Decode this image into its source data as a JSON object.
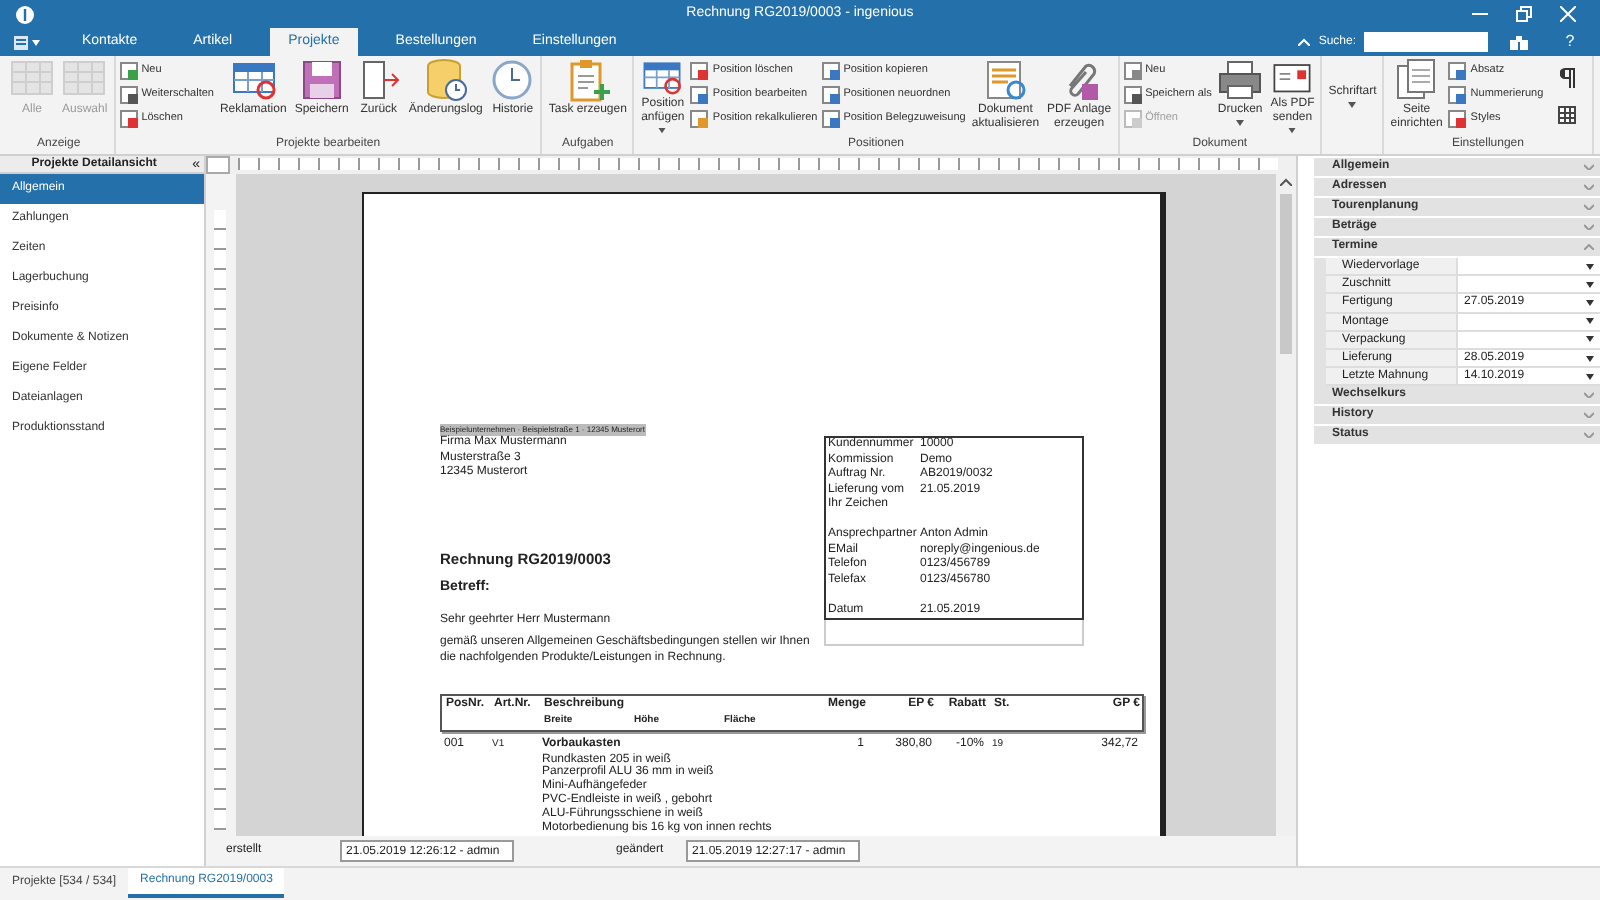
{
  "window": {
    "title": "Rechnung RG2019/0003 - ingenious"
  },
  "tabs": [
    {
      "label": "Kontakte",
      "selected": false
    },
    {
      "label": "Artikel",
      "selected": false
    },
    {
      "label": "Projekte",
      "selected": true
    },
    {
      "label": "Bestellungen",
      "selected": false
    },
    {
      "label": "Einstellungen",
      "selected": false
    }
  ],
  "search": {
    "label": "Suche:",
    "help": "?"
  },
  "ribbon": [
    {
      "label": "Anzeige",
      "items": [
        {
          "kind": "large",
          "label": "Alle",
          "disabled": true,
          "dropdown": false
        },
        {
          "kind": "large",
          "label": "Auswahl",
          "disabled": true,
          "dropdown": false
        }
      ]
    },
    {
      "label": "Projekte bearbeiten",
      "items": [
        {
          "kind": "small_column",
          "items": [
            {
              "label": "Neu",
              "disabled": false
            },
            {
              "label": "Weiterschalten",
              "disabled": false
            },
            {
              "label": "Löschen",
              "disabled": false
            }
          ]
        },
        {
          "kind": "large",
          "label": "Reklamation",
          "disabled": false,
          "dropdown": false
        },
        {
          "kind": "large",
          "label": "Speichern",
          "disabled": false,
          "dropdown": false
        },
        {
          "kind": "large",
          "label": "Zurück",
          "disabled": false,
          "dropdown": false
        },
        {
          "kind": "large",
          "label": "Änderungslog",
          "disabled": false,
          "dropdown": false
        },
        {
          "kind": "large",
          "label": "Historie",
          "disabled": false,
          "dropdown": false
        }
      ]
    },
    {
      "label": "Aufgaben",
      "items": [
        {
          "kind": "large",
          "label": "Task erzeugen",
          "disabled": false,
          "dropdown": false
        }
      ]
    },
    {
      "label": "Positionen",
      "items": [
        {
          "kind": "large",
          "label": "Position\nanfügen",
          "disabled": false,
          "dropdown": true
        },
        {
          "kind": "small_column",
          "items": [
            {
              "label": "Position löschen",
              "disabled": false
            },
            {
              "label": "Position bearbeiten",
              "disabled": false
            },
            {
              "label": "Position rekalkulieren",
              "disabled": false
            }
          ]
        },
        {
          "kind": "small_column",
          "items": [
            {
              "label": "Position kopieren",
              "disabled": false
            },
            {
              "label": "Positionen neuordnen",
              "disabled": false
            },
            {
              "label": "Position Belegzuweisung",
              "disabled": false
            }
          ]
        },
        {
          "kind": "large",
          "label": "Dokument\naktualisieren",
          "disabled": false,
          "dropdown": false
        },
        {
          "kind": "large",
          "label": "PDF Anlage\nerzeugen",
          "disabled": false,
          "dropdown": false
        }
      ]
    },
    {
      "label": "Dokument",
      "items": [
        {
          "kind": "small_column",
          "items": [
            {
              "label": "Neu",
              "disabled": false
            },
            {
              "label": "Speichern als",
              "disabled": false
            },
            {
              "label": "Öffnen",
              "disabled": true
            }
          ]
        },
        {
          "kind": "large",
          "label": "Drucken",
          "disabled": false,
          "dropdown": true
        },
        {
          "kind": "large",
          "label": "Als PDF\nsenden",
          "disabled": false,
          "dropdown": true
        }
      ]
    },
    {
      "items": [
        {
          "kind": "large",
          "label": "Schriftart",
          "disabled": false,
          "dropdown": true
        }
      ]
    },
    {
      "label": "Einstellungen",
      "items": [
        {
          "kind": "large",
          "label": "Seite\neinrichten",
          "disabled": false,
          "dropdown": false
        },
        {
          "kind": "small_column",
          "items": [
            {
              "label": "Absatz",
              "disabled": false
            },
            {
              "label": "Nummerierung",
              "disabled": false
            },
            {
              "label": "Styles",
              "disabled": false
            }
          ]
        },
        {
          "kind": "icon_column"
        }
      ]
    }
  ],
  "sidebar": {
    "title": "Projekte Detailansicht",
    "collapse": "«",
    "items": [
      {
        "label": "Allgemein",
        "selected": true
      },
      {
        "label": "Zahlungen",
        "selected": false
      },
      {
        "label": "Zeiten",
        "selected": false
      },
      {
        "label": "Lagerbuchung",
        "selected": false
      },
      {
        "label": "Preisinfo",
        "selected": false
      },
      {
        "label": "Dokumente & Notizen",
        "selected": false
      },
      {
        "label": "Eigene Felder",
        "selected": false
      },
      {
        "label": "Dateianlagen",
        "selected": false
      },
      {
        "label": "Produktionsstand",
        "selected": false
      }
    ]
  },
  "document": {
    "sender_line": "Beispielunternehmen · Beispielstraße 1 · 12345 Musterort",
    "recipient": [
      "Firma Max Mustermann",
      "Musterstraße 3",
      "12345 Musterort"
    ],
    "info_groups": [
      [
        {
          "label": "Kundennummer",
          "value": "10000"
        },
        {
          "label": "Kommission",
          "value": "Demo"
        },
        {
          "label": "Auftrag Nr.",
          "value": "AB2019/0032"
        },
        {
          "label": "Lieferung vom",
          "value": "21.05.2019"
        },
        {
          "label": "Ihr Zeichen"
        }
      ],
      [
        {
          "label": "Ansprechpartner",
          "value": "Anton Admin"
        },
        {
          "label": "EMail",
          "value": "noreply@ingenious.de"
        },
        {
          "label": "Telefon",
          "value": "0123/456789"
        },
        {
          "label": "Telefax",
          "value": "0123/456780"
        }
      ],
      [
        {
          "label": "Datum",
          "value": "21.05.2019"
        }
      ]
    ],
    "title": "Rechnung RG2019/0003",
    "subject": "Betreff:",
    "salutation": "Sehr geehrter Herr Mustermann",
    "body_lines": [
      "gemäß unseren Allgemeinen Geschäftsbedingungen stellen wir Ihnen",
      "die nachfolgenden Produkte/Leistungen in Rechnung."
    ],
    "table": {
      "columns": [
        "PosNr.",
        "Art.Nr.",
        "Beschreibung",
        "Menge",
        "EP €",
        "Rabatt",
        "St.",
        "GP €"
      ],
      "subcolumns": [
        "Breite",
        "Höhe",
        "Fläche"
      ],
      "rows": [
        {
          "cells": [
            "001",
            "V1",
            "Vorbaukasten",
            "1",
            "380,80",
            "-10%",
            "19",
            "342,72"
          ],
          "details": [
            "Rundkasten 205 in weiß",
            "Panzerprofil ALU 36 mm in weiß",
            "Mini-Aufhängefeder",
            "PVC-Endleiste in weiß , gebohrt",
            "ALU-Führungsschiene in weiß",
            "Motorbedienung bis 16 kg von innen rechts"
          ]
        }
      ]
    }
  },
  "footer": [
    {
      "label": "erstellt",
      "value": "21.05.2019 12:26:12 - admin"
    },
    {
      "label": "geändert",
      "value": "21.05.2019 12:27:17 - admin"
    }
  ],
  "properties": [
    {
      "title": "Allgemein",
      "expanded": false
    },
    {
      "title": "Adressen",
      "expanded": false
    },
    {
      "title": "Tourenplanung",
      "expanded": false
    },
    {
      "title": "Beträge",
      "expanded": false
    },
    {
      "title": "Termine",
      "expanded": true,
      "fields": [
        {
          "label": "Wiedervorlage"
        },
        {
          "label": "Zuschnitt"
        },
        {
          "label": "Fertigung",
          "value": "27.05.2019"
        },
        {
          "label": "Montage"
        },
        {
          "label": "Verpackung"
        },
        {
          "label": "Lieferung",
          "value": "28.05.2019"
        },
        {
          "label": "Letzte Mahnung",
          "value": "14.10.2019"
        }
      ]
    },
    {
      "title": "Wechselkurs",
      "expanded": false
    },
    {
      "title": "History",
      "expanded": false
    },
    {
      "title": "Status",
      "expanded": false
    }
  ],
  "bottom_tabs": [
    {
      "label": "Projekte [534 / 534]",
      "selected": false
    },
    {
      "label": "Rechnung RG2019/0003",
      "selected": true
    }
  ]
}
